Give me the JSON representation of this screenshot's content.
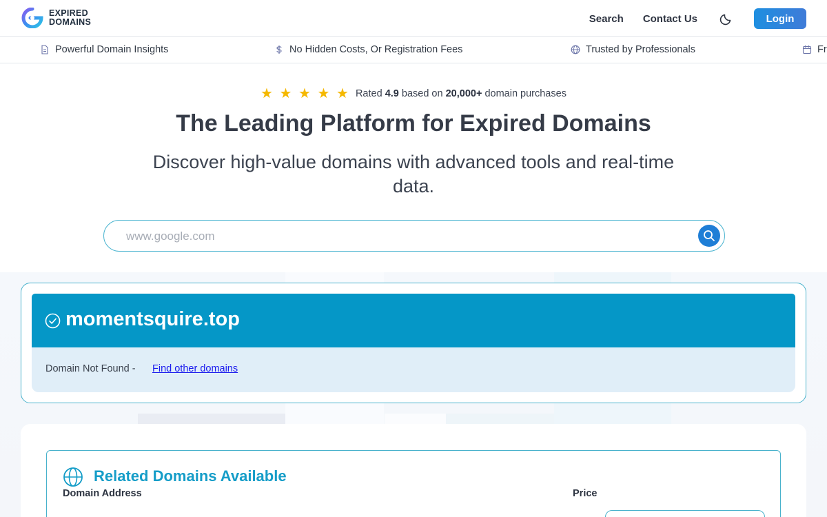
{
  "brand": {
    "line1": "EXPIRED",
    "line2": "DOMAINS"
  },
  "nav": {
    "search": "Search",
    "contact": "Contact Us",
    "login": "Login"
  },
  "features": [
    {
      "icon": "document-icon",
      "label": "Powerful Domain Insights"
    },
    {
      "icon": "dollar-icon",
      "label": "No Hidden Costs, Or Registration Fees"
    },
    {
      "icon": "globe-icon",
      "label": "Trusted by Professionals"
    },
    {
      "icon": "calendar-icon",
      "label": "Fre"
    }
  ],
  "hero": {
    "stars": "★ ★ ★ ★ ★",
    "rated_prefix": "Rated",
    "rating": "4.9",
    "based_on": "based on",
    "purchases": "20,000+",
    "purchases_suffix": "domain purchases",
    "title": "The Leading Platform for Expired Domains",
    "subtitle": "Discover high-value domains with advanced tools and real-time data."
  },
  "search": {
    "placeholder": "www.google.com",
    "value": ""
  },
  "result": {
    "domain": "momentsquire.top",
    "status": "Domain Not Found -",
    "link": "Find other domains"
  },
  "related": {
    "title": "Related Domains Available",
    "col_domain": "Domain Address",
    "col_price": "Price"
  },
  "colors": {
    "accent": "#0597c7",
    "login": "#1e8fe0",
    "stars": "#f5b800",
    "link": "#1a1aee"
  }
}
